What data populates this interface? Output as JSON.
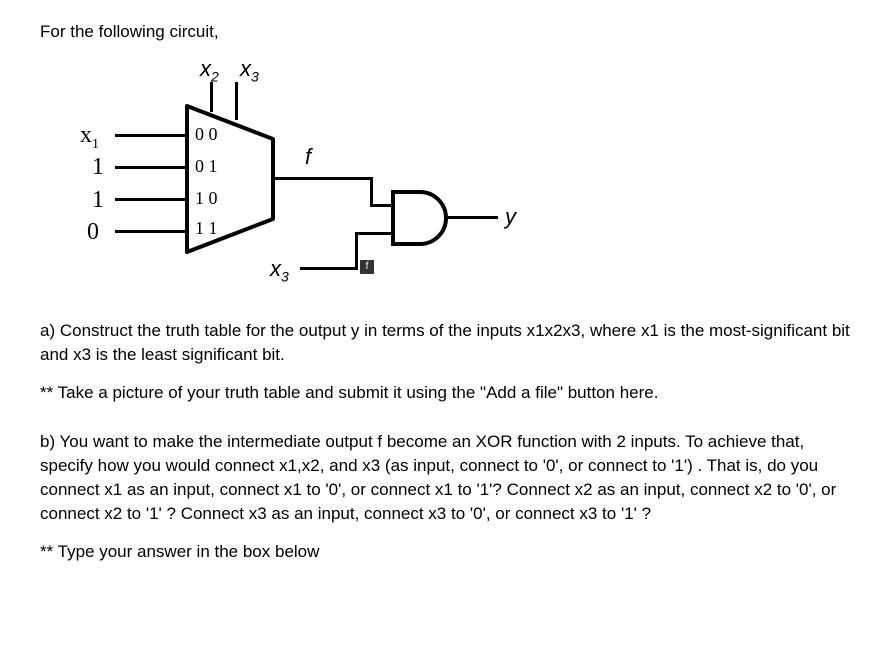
{
  "intro": "For the following circuit,",
  "diagram": {
    "select_x2": "x",
    "select_x2_sub": "2",
    "select_x3": "x",
    "select_x3_sub": "3",
    "input_x1": "x",
    "input_x1_sub": "1",
    "input_1a": "1",
    "input_1b": "1",
    "input_0": "0",
    "mux_00": "0 0",
    "mux_01": "0 1",
    "mux_10": "1 0",
    "mux_11": "1 1",
    "f_label": "f",
    "x3_bottom": "x",
    "x3_bottom_sub": "3",
    "y_label": "y",
    "small_f": "f"
  },
  "question_a": "a) Construct the truth table for the output y in terms of the inputs x1x2x3, where x1 is the most-significant bit and x3 is the least significant bit.",
  "instruction_a": "** Take a picture of your truth table and submit it using the \"Add a file\" button here.",
  "question_b": "b) You want to make the intermediate output f become an XOR function with 2 inputs. To achieve that, specify how you would connect x1,x2, and x3  (as input, connect to '0', or connect to '1') . That is, do you connect x1 as an input, connect x1 to '0', or connect x1 to '1'? Connect x2 as an input, connect x2 to '0', or connect x2 to '1' ? Connect x3 as an input, connect x3 to '0', or connect x3 to '1' ?",
  "instruction_b": "** Type your answer in the box below"
}
